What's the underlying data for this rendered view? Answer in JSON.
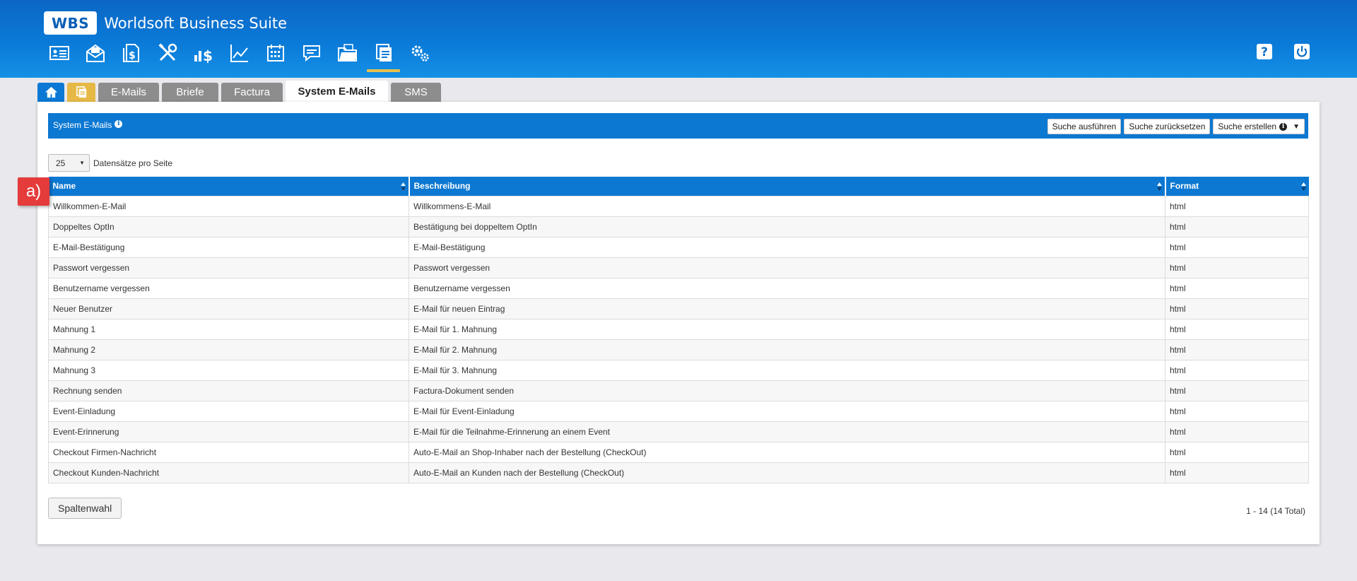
{
  "app": {
    "logo_badge": "WBS",
    "title": "Worldsoft Business Suite"
  },
  "toolbar": {
    "icons": [
      "contacts-icon",
      "mail-icon",
      "invoice-icon",
      "tools-icon",
      "finance-icon",
      "chart-icon",
      "calendar-icon",
      "comments-icon",
      "folder-icon",
      "documents-icon",
      "settings-icon"
    ],
    "active": "documents-icon",
    "right_icons": [
      "help-icon",
      "power-icon"
    ]
  },
  "tabs": {
    "items": [
      "E-Mails",
      "Briefe",
      "Factura",
      "System E-Mails",
      "SMS"
    ],
    "active": "System E-Mails"
  },
  "panel": {
    "title": "System E-Mails",
    "buttons": {
      "search": "Suche ausführen",
      "reset": "Suche zurücksetzen",
      "create": "Suche erstellen"
    }
  },
  "pager": {
    "per_page": "25",
    "per_page_label": "Datensätze pro Seite",
    "total": "1 - 14 (14 Total)"
  },
  "table": {
    "columns": [
      "Name",
      "Beschreibung",
      "Format"
    ],
    "rows": [
      [
        "Willkommen-E-Mail",
        "Willkommens-E-Mail",
        "html"
      ],
      [
        "Doppeltes OptIn",
        "Bestätigung bei doppeltem OptIn",
        "html"
      ],
      [
        "E-Mail-Bestätigung",
        "E-Mail-Bestätigung",
        "html"
      ],
      [
        "Passwort vergessen",
        "Passwort vergessen",
        "html"
      ],
      [
        "Benutzername vergessen",
        "Benutzername vergessen",
        "html"
      ],
      [
        "Neuer Benutzer",
        "E-Mail für neuen Eintrag",
        "html"
      ],
      [
        "Mahnung 1",
        "E-Mail für 1. Mahnung",
        "html"
      ],
      [
        "Mahnung 2",
        "E-Mail für 2. Mahnung",
        "html"
      ],
      [
        "Mahnung 3",
        "E-Mail für 3. Mahnung",
        "html"
      ],
      [
        "Rechnung senden",
        "Factura-Dokument senden",
        "html"
      ],
      [
        "Event-Einladung",
        "E-Mail für Event-Einladung",
        "html"
      ],
      [
        "Event-Erinnerung",
        "E-Mail für die Teilnahme-Erinnerung an einem Event",
        "html"
      ],
      [
        "Checkout Firmen-Nachricht",
        "Auto-E-Mail an Shop-Inhaber nach der Bestellung (CheckOut)",
        "html"
      ],
      [
        "Checkout Kunden-Nachricht",
        "Auto-E-Mail an Kunden nach der Bestellung (CheckOut)",
        "html"
      ]
    ]
  },
  "footer": {
    "column_choice": "Spaltenwahl"
  },
  "annotation": {
    "callout": "a)"
  },
  "colors": {
    "header_blue": "#0a7ad8",
    "accent_yellow": "#e8c04a",
    "callout_red": "#e53b3b"
  }
}
